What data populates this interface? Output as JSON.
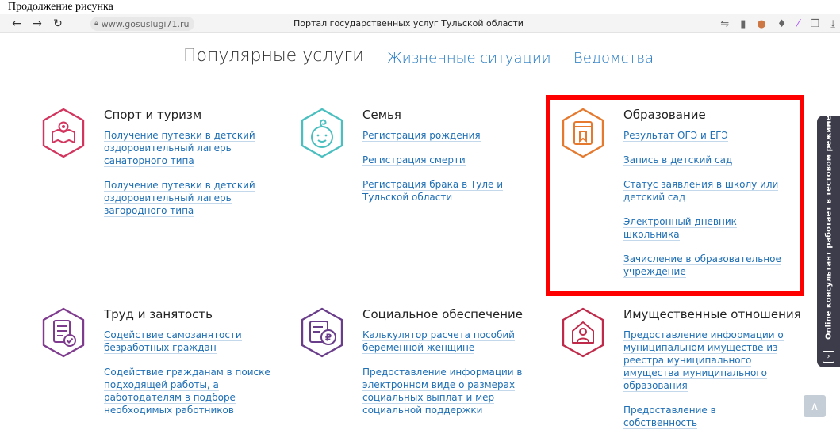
{
  "caption": "Продолжение рисунка",
  "browser": {
    "url": "www.gosuslugi71.ru",
    "title": "Портал государственных услуг Тульской области"
  },
  "nav": {
    "popular": "Популярные услуги",
    "life": "Жизненные ситуации",
    "dept": "Ведомства"
  },
  "cards": {
    "sport": {
      "title": "Спорт и туризм",
      "links": [
        "Получение путевки в детский оздоровительный лагерь санаторного типа",
        "Получение путевки в детский оздоровительный лагерь загородного типа"
      ]
    },
    "family": {
      "title": "Семья",
      "links": [
        "Регистрация рождения",
        "Регистрация смерти",
        "Регистрация брака в Туле и Тульской области"
      ]
    },
    "education": {
      "title": "Образование",
      "links": [
        "Результат ОГЭ и ЕГЭ",
        "Запись в детский сад",
        "Статус заявления в школу или детский сад",
        "Электронный дневник школьника",
        "Зачисление в образовательное учреждение"
      ]
    },
    "work": {
      "title": "Труд и занятость",
      "links": [
        "Содействие самозанятости безработных граждан",
        "Содействие гражданам в поиске подходящей работы, а работодателям в подборе необходимых работников"
      ]
    },
    "social": {
      "title": "Социальное обеспечение",
      "links": [
        "Калькулятор расчета пособий беременной женщине",
        "Предоставление информации в электронном виде о размерах социальных выплат и мер социальной поддержки"
      ]
    },
    "property": {
      "title": "Имущественные отношения",
      "links": [
        "Предоставление информации о муниципальном имуществе из реестра муниципального имущества муниципального образования",
        "Предоставление в собственность"
      ]
    }
  },
  "consultant": "Online консультант работает в тестовом режиме",
  "colors": {
    "sport": "#d2355e",
    "family": "#4bbfc0",
    "education": "#e57a2f",
    "work": "#7f3b8e",
    "social": "#6a3d8a",
    "property": "#c02a4a",
    "link": "#1f6fb5",
    "highlight": "#ff0000"
  }
}
